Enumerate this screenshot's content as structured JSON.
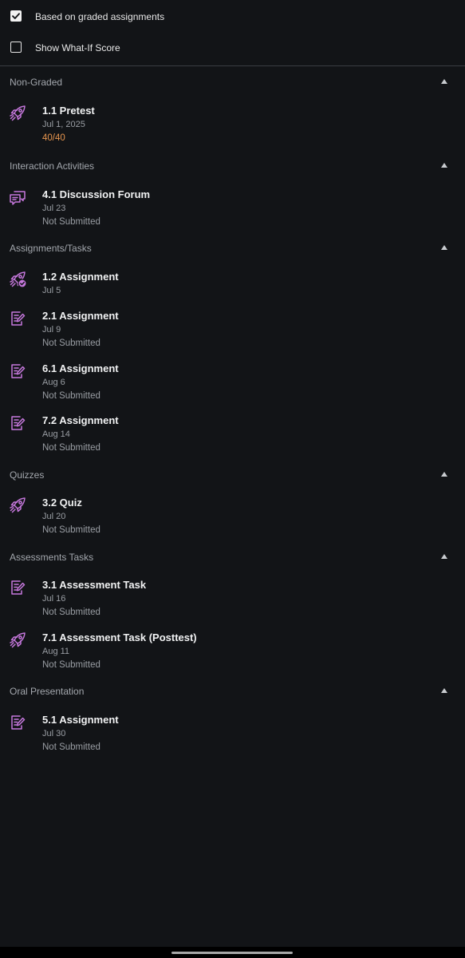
{
  "options": {
    "graded": {
      "label": "Based on graded assignments",
      "checked": true
    },
    "whatif": {
      "label": "Show What-If Score",
      "checked": false
    }
  },
  "colors": {
    "accent_icon": "#c678dd",
    "score": "#e6954e",
    "background": "#121417"
  },
  "sections": [
    {
      "title": "Non-Graded",
      "items": [
        {
          "icon": "rocket-icon",
          "title": "1.1 Pretest",
          "date": "Jul 1, 2025",
          "status": "40/40"
        }
      ]
    },
    {
      "title": "Interaction Activities",
      "items": [
        {
          "icon": "discussion-icon",
          "title": "4.1 Discussion Forum",
          "date": "Jul 23",
          "status": "Not Submitted"
        }
      ]
    },
    {
      "title": "Assignments/Tasks",
      "items": [
        {
          "icon": "rocket-check-icon",
          "title": "1.2 Assignment",
          "date": "Jul 5"
        },
        {
          "icon": "assignment-icon",
          "title": "2.1 Assignment",
          "date": "Jul 9",
          "status": "Not Submitted"
        },
        {
          "icon": "assignment-icon",
          "title": "6.1 Assignment",
          "date": "Aug 6",
          "status": "Not Submitted"
        },
        {
          "icon": "assignment-icon",
          "title": "7.2 Assignment",
          "date": "Aug 14",
          "status": "Not Submitted"
        }
      ]
    },
    {
      "title": "Quizzes",
      "items": [
        {
          "icon": "rocket-icon",
          "title": "3.2 Quiz",
          "date": "Jul 20",
          "status": "Not Submitted"
        }
      ]
    },
    {
      "title": "Assessments Tasks",
      "items": [
        {
          "icon": "assignment-icon",
          "title": "3.1 Assessment Task",
          "date": "Jul 16",
          "status": "Not Submitted"
        },
        {
          "icon": "rocket-icon",
          "title": "7.1 Assessment Task (Posttest)",
          "date": "Aug 11",
          "status": "Not Submitted"
        }
      ]
    },
    {
      "title": "Oral Presentation",
      "items": [
        {
          "icon": "assignment-icon",
          "title": "5.1 Assignment",
          "date": "Jul 30",
          "status": "Not Submitted"
        }
      ]
    }
  ]
}
